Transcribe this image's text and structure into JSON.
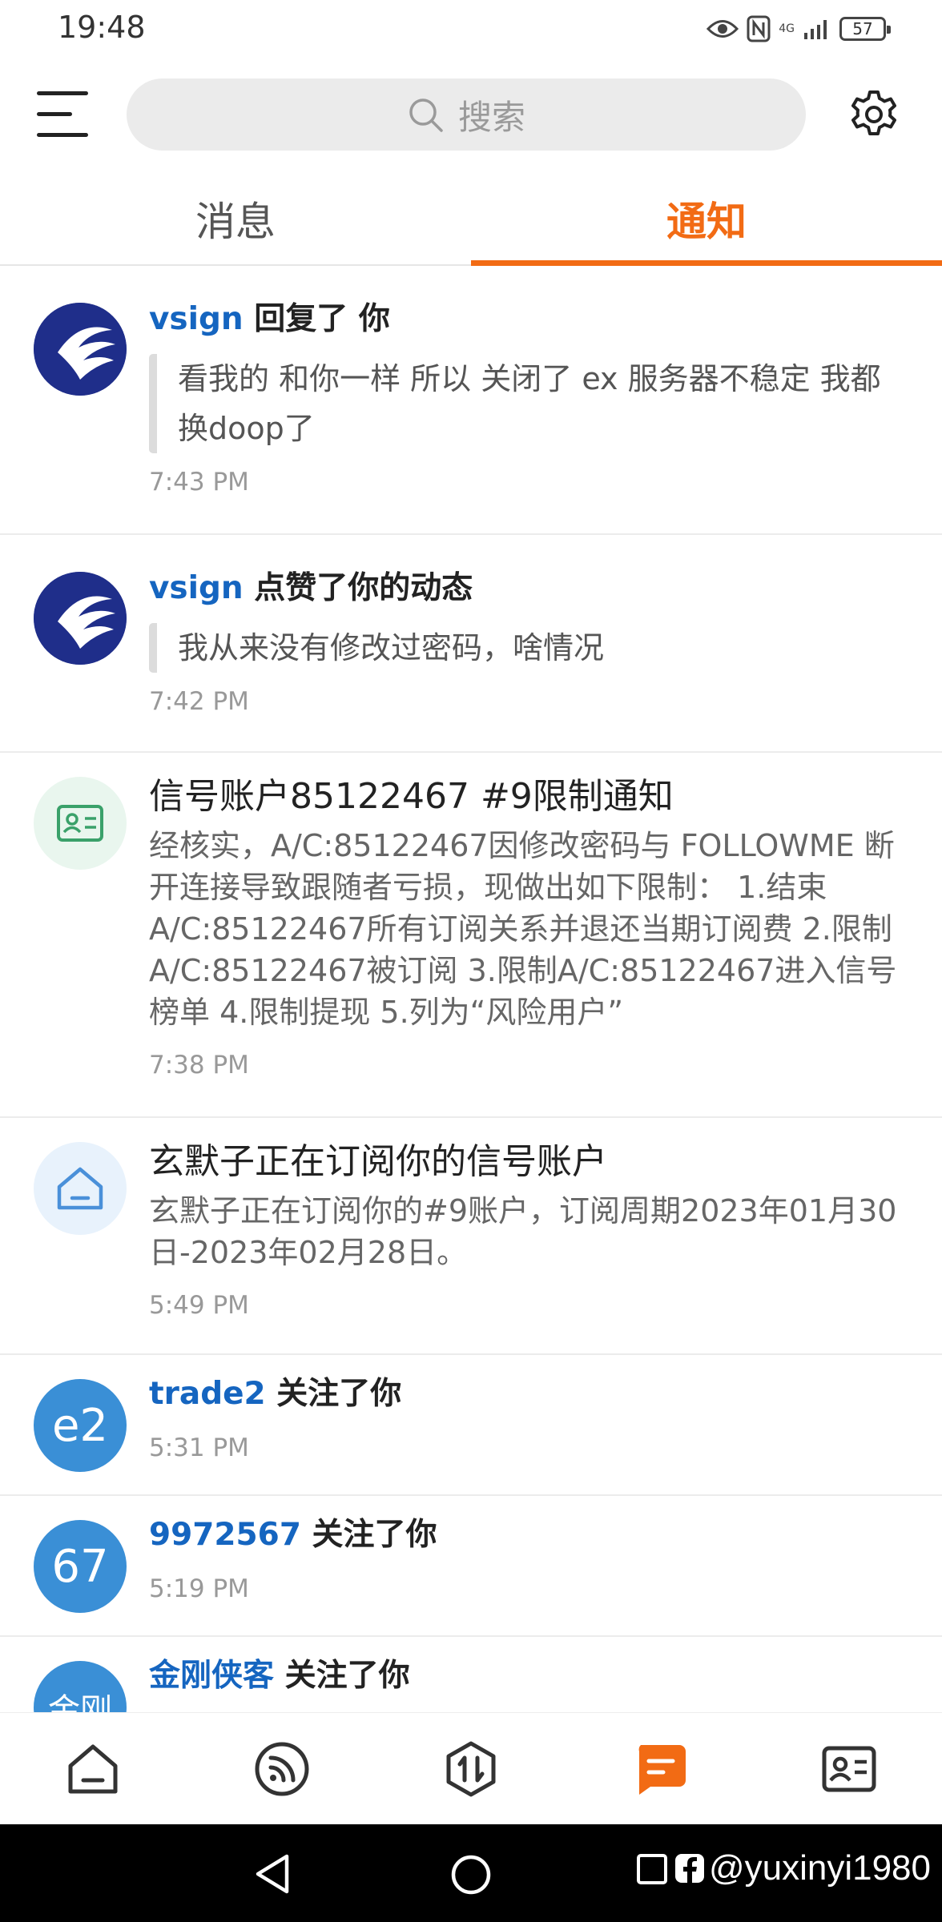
{
  "status_bar": {
    "time": "19:48",
    "network": "4G",
    "battery": "57"
  },
  "search": {
    "placeholder": "搜索"
  },
  "tabs": [
    {
      "label": "消息",
      "active": false
    },
    {
      "label": "通知",
      "active": true
    }
  ],
  "accent_color": "#f26b14",
  "link_color": "#1565c0",
  "notifications": [
    {
      "user": "vsign",
      "action": "回复了 你",
      "quote": "看我的 和你一样 所以 关闭了 ex 服务器不稳定 我都换doop了",
      "time": "7:43 PM"
    },
    {
      "user": "vsign",
      "action": "点赞了你的动态",
      "quote": "我从来没有修改过密码，啥情况",
      "time": "7:42 PM"
    },
    {
      "title": "信号账户85122467 #9限制通知",
      "body": "经核实，A/C:85122467因修改密码与 FOLLOWME 断开连接导致跟随者亏损，现做出如下限制： 1.结束A/C:85122467所有订阅关系并退还当期订阅费 2.限制A/C:85122467被订阅 3.限制A/C:85122467进入信号榜单 4.限制提现 5.列为“风险用户”",
      "time": "7:38 PM"
    },
    {
      "title": "玄默子正在订阅你的信号账户",
      "body": "玄默子正在订阅你的#9账户，订阅周期2023年01月30日-2023年02月28日。",
      "time": "5:49 PM"
    },
    {
      "avatar_text": "e2",
      "user": "trade2",
      "action": "关注了你",
      "time": "5:31 PM"
    },
    {
      "avatar_text": "67",
      "user": "9972567",
      "action": "关注了你",
      "time": "5:19 PM"
    },
    {
      "avatar_text": "金刚",
      "user": "金刚侠客",
      "action": "关注了你"
    }
  ],
  "bottom_nav": [
    {
      "icon": "home-icon",
      "active": false
    },
    {
      "icon": "feed-icon",
      "active": false
    },
    {
      "icon": "trade-icon",
      "active": false
    },
    {
      "icon": "message-icon",
      "active": true
    },
    {
      "icon": "profile-card-icon",
      "active": false
    }
  ],
  "watermark": "@yuxinyi1980"
}
